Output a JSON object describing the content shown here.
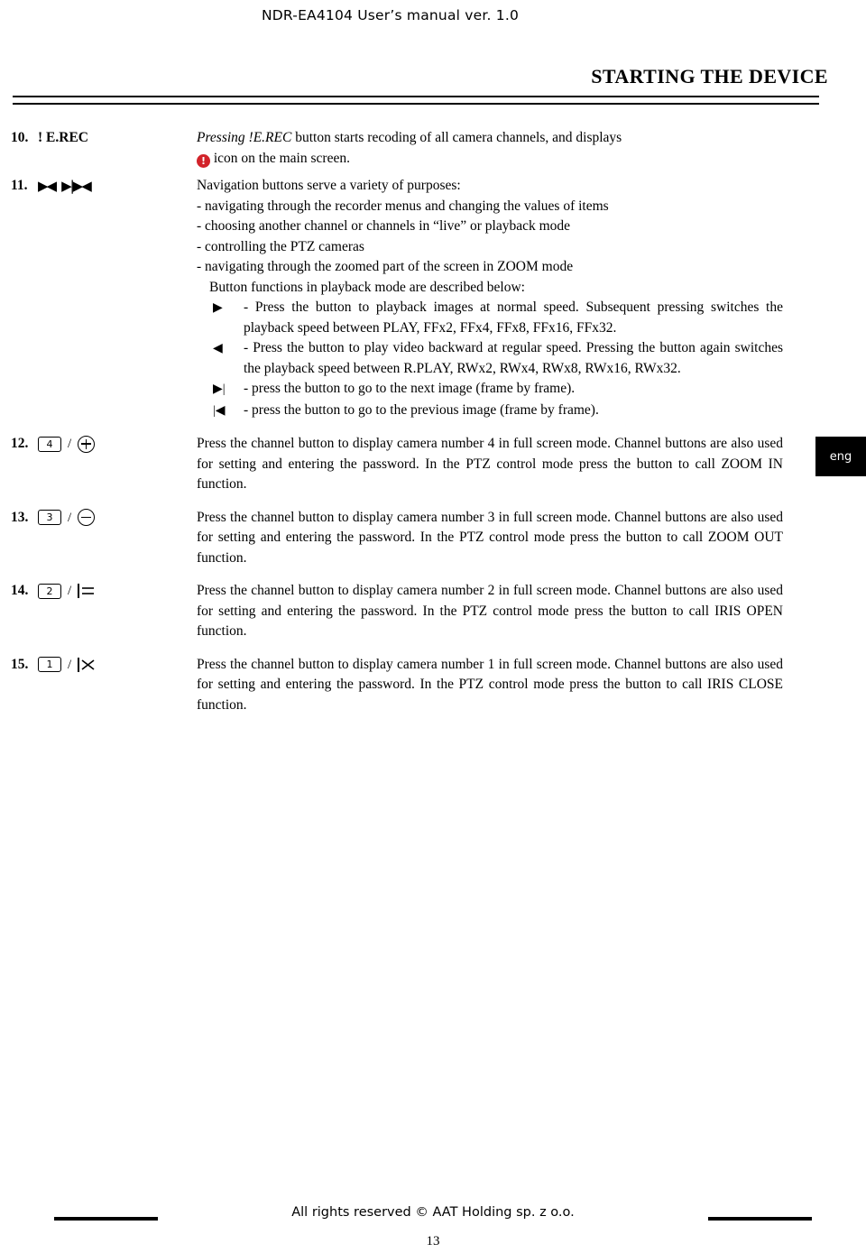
{
  "header": {
    "title": "NDR-EA4104 User’s manual ver. 1.0"
  },
  "section": {
    "title": "STARTING THE DEVICE"
  },
  "side_tab": {
    "label": "eng"
  },
  "items": [
    {
      "number": "10.",
      "key_label": "! E.REC",
      "paragraphs": [
        "Pressing !E.REC button starts recoding of all camera channels, and displays",
        "icon on the main screen."
      ]
    },
    {
      "number": "11.",
      "key_label": "navigation-arrows",
      "intro": "Navigation buttons serve a variety of purposes:",
      "bullets": [
        "- navigating through the recorder menus and changing the values of items",
        "- choosing another channel or channels in “live” or playback mode",
        "- controlling the PTZ cameras",
        "- navigating through the zoomed part of the screen in ZOOM mode"
      ],
      "playback_intro": "Button functions in playback mode are described below:",
      "playback_items": [
        {
          "glyph": "play",
          "text": "- Press the button to playback images at normal speed. Subsequent pressing switches the playback speed between PLAY, FFx2, FFx4, FFx8, FFx16, FFx32."
        },
        {
          "glyph": "reverse",
          "text": "- Press the button to play video backward at regular speed. Pressing the button again switches the playback speed between R.PLAY, RWx2, RWx4, RWx8, RWx16, RWx32."
        },
        {
          "glyph": "step-forward",
          "text": "- press the button to go to the next image (frame by frame)."
        },
        {
          "glyph": "step-backward",
          "text": "- press the button to go to the previous image (frame by frame)."
        }
      ]
    },
    {
      "number": "12.",
      "key_digit": "4",
      "key_icon": "zoom-in-plus",
      "text": "Press the channel button to display camera number 4 in full screen mode. Channel buttons are also used for setting and entering the password. In the PTZ control mode press the button to call ZOOM IN function."
    },
    {
      "number": "13.",
      "key_digit": "3",
      "key_icon": "zoom-out-minus",
      "text": "Press the channel button to display camera number 3 in full screen mode. Channel buttons are also used for setting and entering the password. In the PTZ control mode press the button to call ZOOM OUT function."
    },
    {
      "number": "14.",
      "key_digit": "2",
      "key_icon": "iris-open",
      "text": "Press the channel button to display camera number 2 in full screen mode. Channel buttons are also used for setting and entering the password. In the PTZ control mode press the button to call IRIS OPEN function."
    },
    {
      "number": "15.",
      "key_digit": "1",
      "key_icon": "iris-close",
      "text": "Press the channel button to display camera number 1 in full screen mode. Channel buttons are also used for setting and entering the password. In the PTZ control mode press the button to call IRIS CLOSE function."
    }
  ],
  "footer": {
    "text": "All rights reserved © AAT Holding sp. z o.o.",
    "page_number": "13"
  }
}
